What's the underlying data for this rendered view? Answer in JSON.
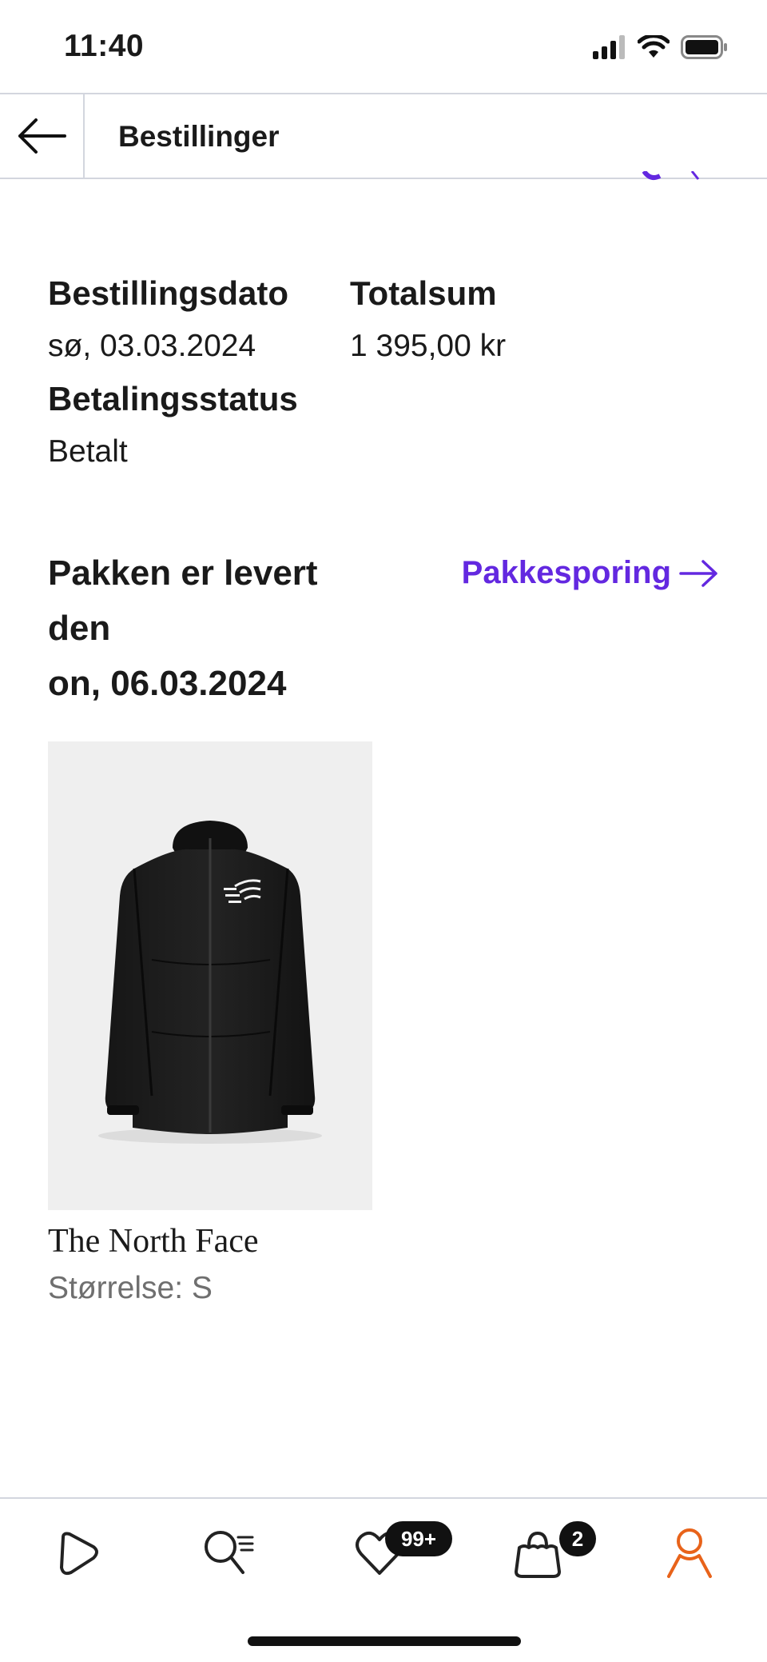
{
  "status_bar": {
    "time": "11:40"
  },
  "header": {
    "title": "Bestillinger"
  },
  "order": {
    "date_label": "Bestillingsdato",
    "date_value": "sø, 03.03.2024",
    "total_label": "Totalsum",
    "total_value": "1 395,00 kr",
    "payment_label": "Betalingsstatus",
    "payment_value": "Betalt"
  },
  "delivery": {
    "line1": "Pakken er levert",
    "line2": "den",
    "line3": "on, 06.03.2024",
    "tracking_label": "Pakkesporing"
  },
  "product": {
    "brand": "The North Face",
    "size": "Størrelse: S"
  },
  "bottom_nav": {
    "wishlist_badge": "99+",
    "cart_badge": "2",
    "active_item": "profile"
  },
  "colors": {
    "accent": "#6328e0",
    "active_nav": "#e8631a",
    "divider": "#d3d6de"
  }
}
